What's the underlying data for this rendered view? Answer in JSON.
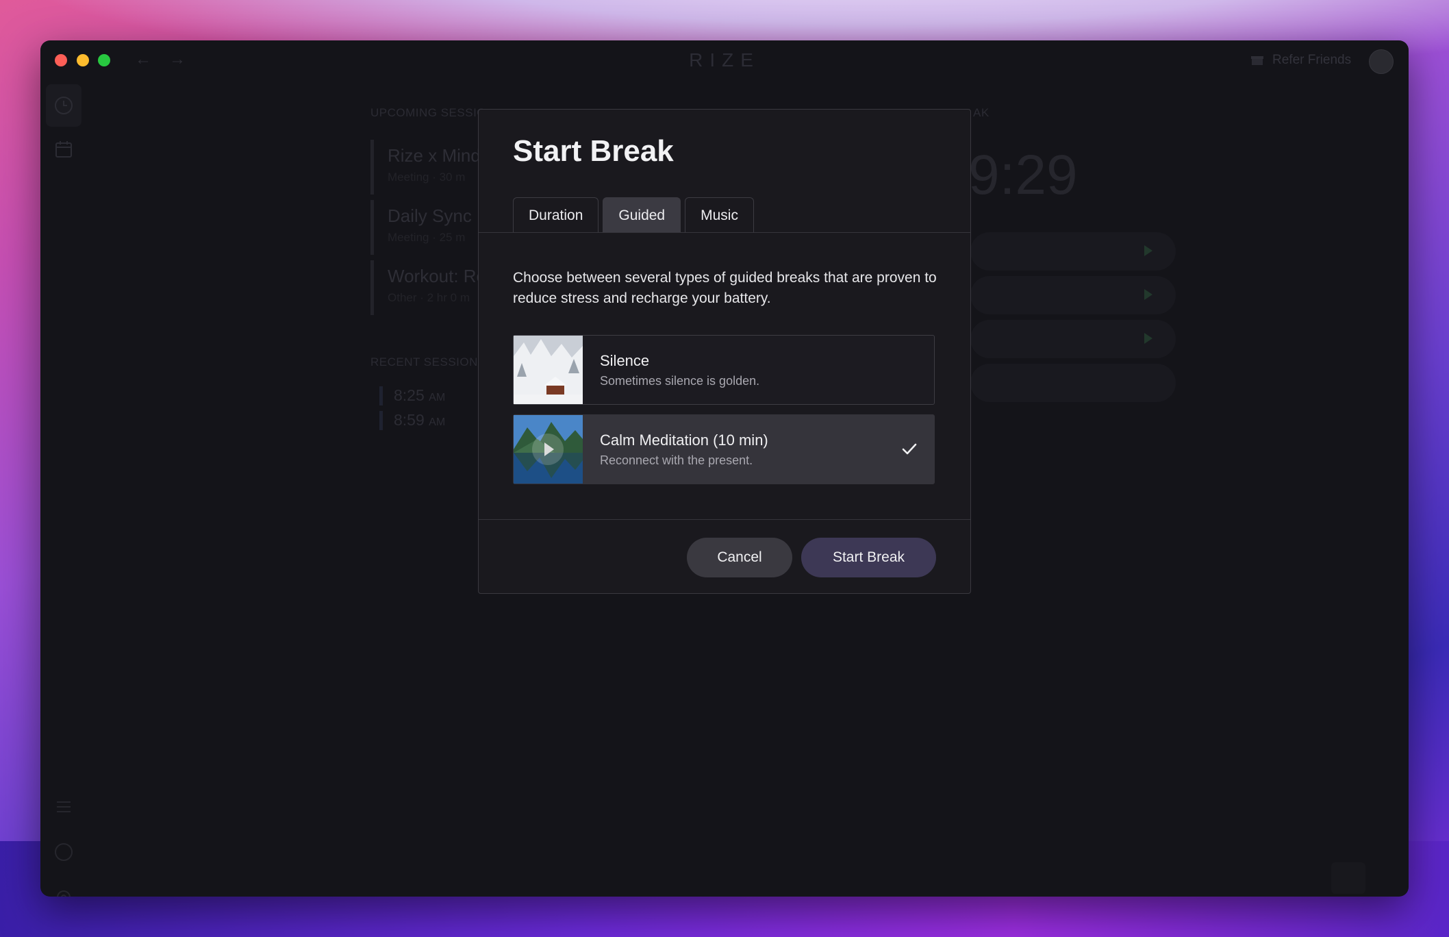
{
  "window": {
    "app_title": "RIZE",
    "refer_label": "Refer Friends",
    "nav_back": "←",
    "nav_forward": "→"
  },
  "background": {
    "upcoming_label": "UPCOMING SESSIO",
    "break_label": "AK",
    "sessions": [
      {
        "title": "Rize x Minds",
        "subtitle": "Meeting · 30 m"
      },
      {
        "title": "Daily Sync",
        "subtitle": "Meeting · 25 m"
      },
      {
        "title": "Workout: Re",
        "subtitle": "Other · 2 hr 0 m"
      }
    ],
    "recent_label": "RECENT SESSIONS",
    "recent": [
      {
        "time": "8:25",
        "ampm": "AM"
      },
      {
        "time": "8:59",
        "ampm": "AM"
      }
    ],
    "timer": "9:29"
  },
  "modal": {
    "title": "Start Break",
    "tabs": [
      {
        "label": "Duration",
        "active": false
      },
      {
        "label": "Guided",
        "active": true
      },
      {
        "label": "Music",
        "active": false
      }
    ],
    "description": "Choose between several types of guided breaks that are proven to reduce stress and recharge your battery.",
    "options": [
      {
        "name": "Silence",
        "subtitle": "Sometimes silence is golden.",
        "selected": false,
        "thumb_icon": "snowy-cabin-image"
      },
      {
        "name": "Calm Meditation (10 min)",
        "subtitle": "Reconnect with the present.",
        "selected": true,
        "thumb_icon": "mountain-lake-image"
      }
    ],
    "cancel_label": "Cancel",
    "start_label": "Start Break"
  },
  "colors": {
    "accent": "#3d3855",
    "selected_bg": "#35343b",
    "window_bg": "#141419"
  }
}
